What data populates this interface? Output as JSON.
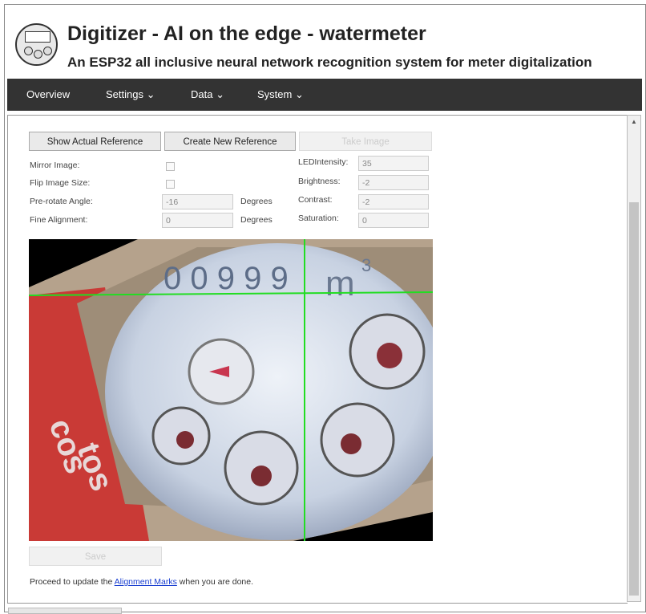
{
  "header": {
    "title": "Digitizer - AI on the edge - watermeter",
    "subtitle": "An ESP32 all inclusive neural network recognition system for meter digitalization"
  },
  "nav": {
    "items": [
      {
        "label": "Overview"
      },
      {
        "label": "Settings ⌄"
      },
      {
        "label": "Data ⌄"
      },
      {
        "label": "System ⌄"
      }
    ]
  },
  "toolbar": {
    "show_reference": "Show Actual Reference",
    "create_reference": "Create New Reference",
    "take_image": "Take Image"
  },
  "settings": {
    "mirror_label": "Mirror Image:",
    "flip_label": "Flip Image Size:",
    "prerotate_label": "Pre-rotate Angle:",
    "prerotate_value": "-16",
    "prerotate_unit": "Degrees",
    "fine_label": "Fine Alignment:",
    "fine_value": "0",
    "fine_unit": "Degrees",
    "led_label": "LEDIntensity:",
    "led_value": "35",
    "brightness_label": "Brightness:",
    "brightness_value": "-2",
    "contrast_label": "Contrast:",
    "contrast_value": "-2",
    "saturation_label": "Saturation:",
    "saturation_value": "0"
  },
  "image": {
    "digits": "0 0 9 9 9",
    "unit": "m",
    "unit_exp": "3"
  },
  "save_label": "Save",
  "footer": {
    "before": "Proceed to update the ",
    "link": "Alignment Marks",
    "after": " when you are done."
  },
  "colors": {
    "navbar": "#333333",
    "link": "#1a3fd1",
    "crosshair": "#22dd22"
  }
}
